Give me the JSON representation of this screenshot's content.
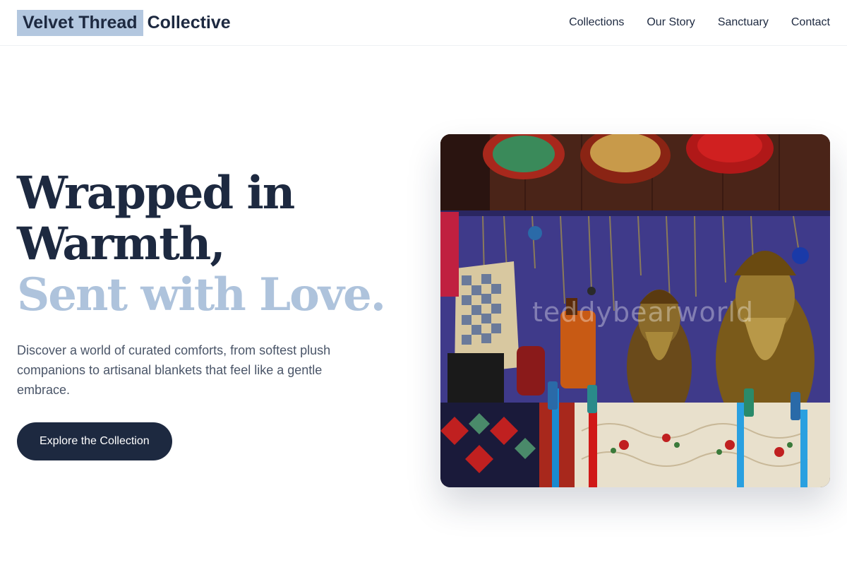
{
  "header": {
    "logo_highlight": "Velvet Thread",
    "logo_rest": "Collective",
    "nav": [
      "Collections",
      "Our Story",
      "Sanctuary",
      "Contact"
    ]
  },
  "hero": {
    "headline_line1": "Wrapped in",
    "headline_line2": "Warmth,",
    "headline_accent": "Sent with Love.",
    "subtext": "Discover a world of curated comforts, from softest plush companions to artisanal blankets that feel like a gentle embrace.",
    "cta_label": "Explore the Collection",
    "image_watermark": "teddybearworld"
  },
  "colors": {
    "primary": "#1d2940",
    "accent": "#aec3dc",
    "logo_highlight_bg": "#b3c7df"
  }
}
